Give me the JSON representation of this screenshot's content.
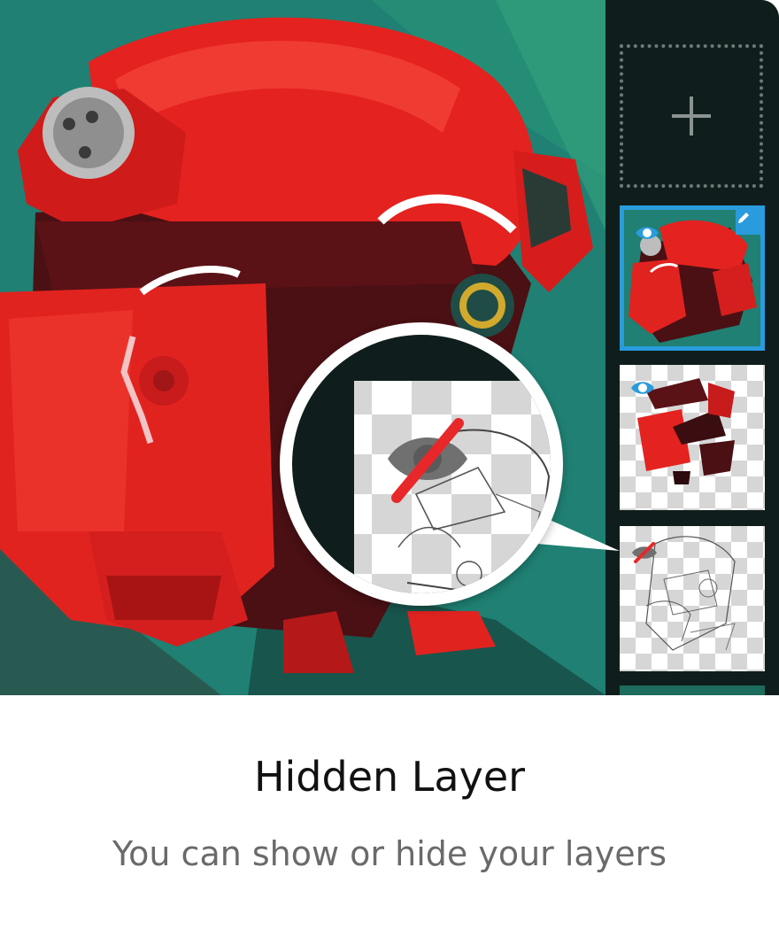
{
  "caption": {
    "title": "Hidden Layer",
    "subtitle": "You can show or hide your layers"
  },
  "layers_panel": {
    "add_icon": "plus-icon",
    "layers": [
      {
        "name": "layer-1-color",
        "visible": true,
        "selected": true,
        "badge_icon": "pencil-icon"
      },
      {
        "name": "layer-2-shapes",
        "visible": true,
        "selected": false
      },
      {
        "name": "layer-3-sketch",
        "visible": false,
        "selected": false
      },
      {
        "name": "layer-4-partial",
        "visible": true,
        "selected": false
      }
    ]
  },
  "magnifier": {
    "icon": "hidden-eye-icon"
  },
  "colors": {
    "accent": "#2a9bdc",
    "hidden_strike": "#e8272a",
    "panel_bg": "#0f1e1c",
    "robot_red": "#e4221f",
    "teal_bg": "#1f7f73"
  }
}
